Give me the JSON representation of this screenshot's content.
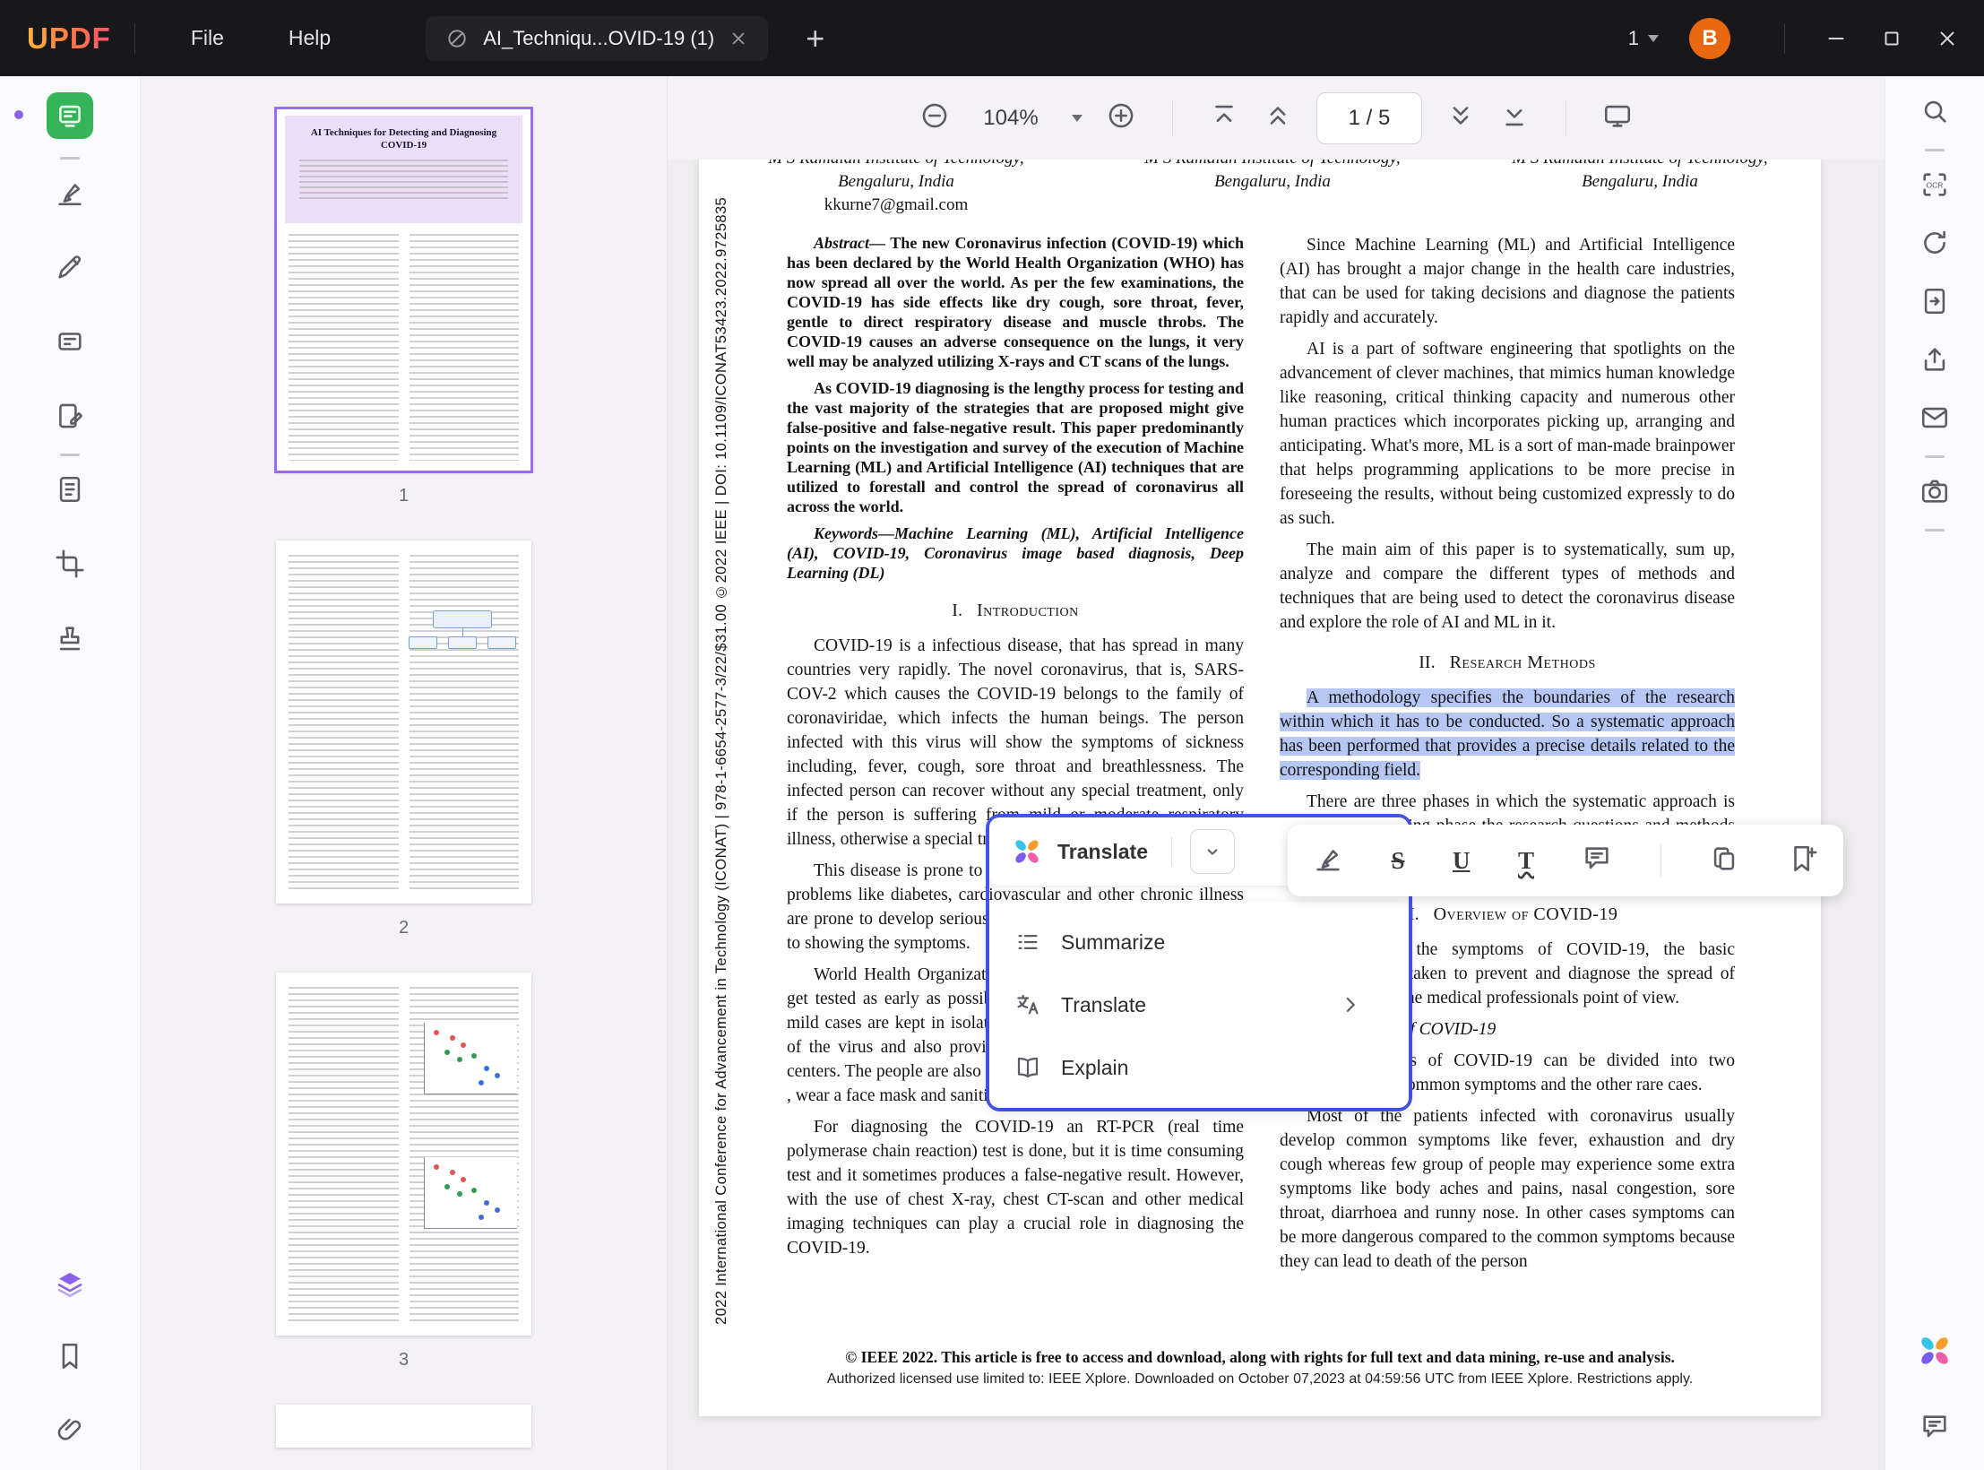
{
  "titlebar": {
    "logo": "UPDF",
    "menus": {
      "file": "File",
      "help": "Help"
    },
    "tab": {
      "title": "AI_Techniqu...OVID-19 (1)"
    },
    "new_tab_glyph": "+",
    "open_count": "1",
    "avatar_initial": "B"
  },
  "doc_toolbar": {
    "zoom_level": "104%",
    "page_indicator": "1 / 5"
  },
  "thumbnail_panel": {
    "page1_title": "AI Techniques for Detecting and Diagnosing COVID-19",
    "page_labels": [
      "1",
      "2",
      "3"
    ]
  },
  "right_rail": {
    "ocr_label": "OCR"
  },
  "ai_popup": {
    "header_label": "Translate",
    "items": [
      {
        "label": "Summarize"
      },
      {
        "label": "Translate"
      },
      {
        "label": "Explain"
      }
    ]
  },
  "fmt_bar": {
    "strike_glyph": "S",
    "underline_glyph": "U",
    "squiggly_glyph": "T"
  },
  "colors": {
    "popup_border": "#4555e8",
    "selection_highlight": "#b7c7f3",
    "avatar_bg": "#e8680f",
    "active_tool_green": "#35b558",
    "layers_purple": "#8a63e8",
    "selected_thumb_border": "#9b6bf2"
  },
  "document": {
    "side_text": "2022 International Conference for Advancement in Technology (ICONAT) | 978-1-6654-2577-3/22/$31.00 ©2022 IEEE | DOI: 10.1109/ICONAT53423.2022.9725835",
    "aff1_l1": "M S Ramaiah Institute of Technology,",
    "aff1_l2": "Bengaluru, India",
    "aff1_email": "kkurne7@gmail.com",
    "aff2_l1": "M S Ramaiah Institute of Technology,",
    "aff2_l2": "Bengaluru, India",
    "aff3_l1": "M S Ramaiah Institute of Technology,",
    "aff3_l2": "Bengaluru, India",
    "abstract_label": "Abstract—",
    "abstract_body": "The new Coronavirus infection (COVID-19) which has been declared by the World Health Organization (WHO) has now spread all over the world. As per the few examinations, the COVID-19 has side effects like dry cough, sore throat, fever, gentle to direct respiratory disease and muscle throbs. The COVID-19 causes an adverse consequence on the lungs, it very well may be analyzed utilizing X-rays and CT scans of the lungs.",
    "abstract_p2": "As COVID-19 diagnosing is the lengthy process for testing and the vast majority of the strategies that are proposed might give false-positive and false-negative result. This paper predominantly points on the investigation and survey of the execution of Machine Learning (ML) and Artificial Intelligence (AI) techniques that are utilized to forestall and control the spread of coronavirus all across the world.",
    "keywords": "Keywords—Machine Learning (ML), Artificial Intelligence (AI), COVID-19, Coronavirus image based diagnosis, Deep Learning (DL)",
    "sec1_num": "I.",
    "sec1_title": "Introduction",
    "intro_p1": "COVID-19 is a infectious disease, that has spread in many countries very rapidly. The novel coronavirus, that is, SARS-COV-2 which causes the COVID-19 belongs to the family of coronaviridae, which infects the human beings. The person infected with this virus will show the symptoms of sickness including, fever, cough, sore throat and breathlessness. The infected person can recover without any special treatment, only if the person is suffering from mild or moderate respiratory illness, otherwise a special treatment has to be provided.",
    "intro_p2": "This disease is prone to the elderly people and with medical problems like diabetes, cardiovascular and other chronic illness are prone to develop serious illness for about 1 to 14 days prior to showing the symptoms.",
    "intro_p3": "World Health Organization has advised all the countries to get tested as early as possible so that the confirmed cases and mild cases are kept in isolation and this will prevent the spread of the virus and also provides a acceptable care in the health centers. The people are also advised to maintain social distancing , wear a face mask and sanitize the hands frequently.",
    "intro_p4": "For diagnosing the COVID-19 an RT-PCR (real time polymerase chain reaction) test is done, but it is time consuming test and it sometimes produces a false-negative result. However, with the use of chest X-ray, chest CT-scan and other medical imaging techniques can play a crucial role in diagnosing the COVID-19.",
    "rc_p1": "Since Machine Learning (ML) and Artificial Intelligence (AI) has brought a major change in the health care industries, that can be used for taking decisions and diagnose the patients rapidly and accurately.",
    "rc_p2": "AI is a part of software engineering that spotlights on the advancement of clever machines, that mimics human knowledge like reasoning, critical thinking capacity and numerous other human practices which incorporates picking up, arranging and anticipating. What's more, ML is a sort of man-made brainpower that helps programming applications to be more precise in foreseeing the results, without being customized expressly to do as such.",
    "rc_p3": "The main aim of this paper is to systematically, sum up, analyze and compare the different types of methods and techniques that are being used to detect the coronavirus disease and explore the role of AI and ML in it.",
    "sec2_num": "II.",
    "sec2_title": "Research Methods",
    "selection_text": "A methodology specifies the boundaries of the research within which it has to be conducted. So a systematic approach has been performed that provides a precise details related to the corresponding field.",
    "methods_p": "There are three phases in which the systematic approach is used. In the planning phase the research questions and methods that are used to collect the data are identified. The analysis of the extracted data is used for getting the result.",
    "sec3_num": "III.",
    "sec3_title": "Overview of COVID-19",
    "overview_p": "By knowing the symptoms of COVID-19, the basic measures can be taken to prevent and diagnose the spread of COVID-19 from the medical professionals point of view.",
    "sub_a": "A.   Symptoms of COVID-19",
    "sym_p1": "The symptoms of COVID-19 can be divided into two categories based common symptoms and the other rare caes.",
    "sym_p2": "Most of the patients infected with coronavirus usually develop common symptoms like fever, exhaustion and dry cough whereas few group of people may experience some extra symptoms like body aches and pains, nasal congestion, sore throat, diarrhoea and runny nose. In other cases symptoms can be more dangerous compared to the common symptoms because they can lead to death of the person",
    "footer_1": "© IEEE 2022. This article is free to access and download, along with rights for full text and data mining, re-use and analysis.",
    "footer_2": "Authorized licensed use limited to: IEEE Xplore. Downloaded on October 07,2023 at 04:59:56 UTC from IEEE Xplore.  Restrictions apply."
  }
}
